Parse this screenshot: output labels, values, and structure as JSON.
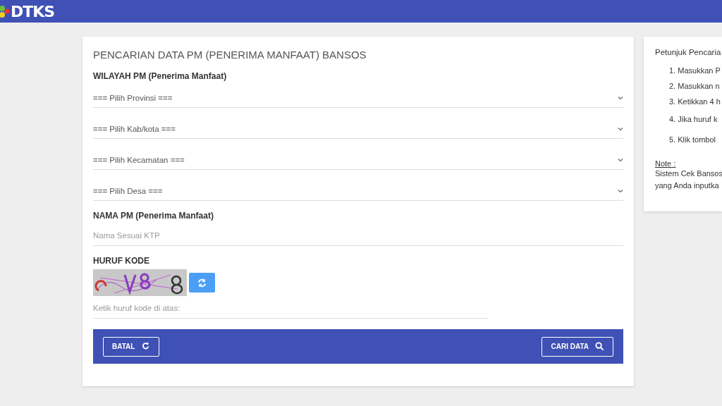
{
  "header": {
    "logo_text": "DTKS"
  },
  "search_form": {
    "title": "PENCARIAN DATA PM (PENERIMA MANFAAT) BANSOS",
    "region_label": "WILAYAH PM (Penerima Manfaat)",
    "region_selects": [
      {
        "placeholder": "=== Pilih Provinsi ==="
      },
      {
        "placeholder": "=== Pilih Kab/kota ==="
      },
      {
        "placeholder": "=== Pilih Kecamatan ==="
      },
      {
        "placeholder": "=== Pilih Desa ==="
      }
    ],
    "name_label": "NAMA PM (Penerima Manfaat)",
    "name_field": {
      "placeholder": "Nama Sesuai KTP"
    },
    "code_label": "HURUF KODE",
    "code_field": {
      "placeholder": "Ketik huruf kode di atas:"
    },
    "buttons": [
      {
        "label": "BATAL",
        "kind": "reset"
      },
      {
        "label": "CARI DATA",
        "kind": "search"
      }
    ]
  },
  "guide": {
    "title": "Petunjuk Pencaria",
    "steps": [
      "1. Masukkan P",
      "2. Masukkan n",
      "3. Ketikkan 4 h",
      "4. Jika huruf k",
      "5. Klik tombol"
    ],
    "note_label": "Note :",
    "note_lines": [
      "Sistem Cek Bansos",
      "yang Anda inputka"
    ]
  }
}
